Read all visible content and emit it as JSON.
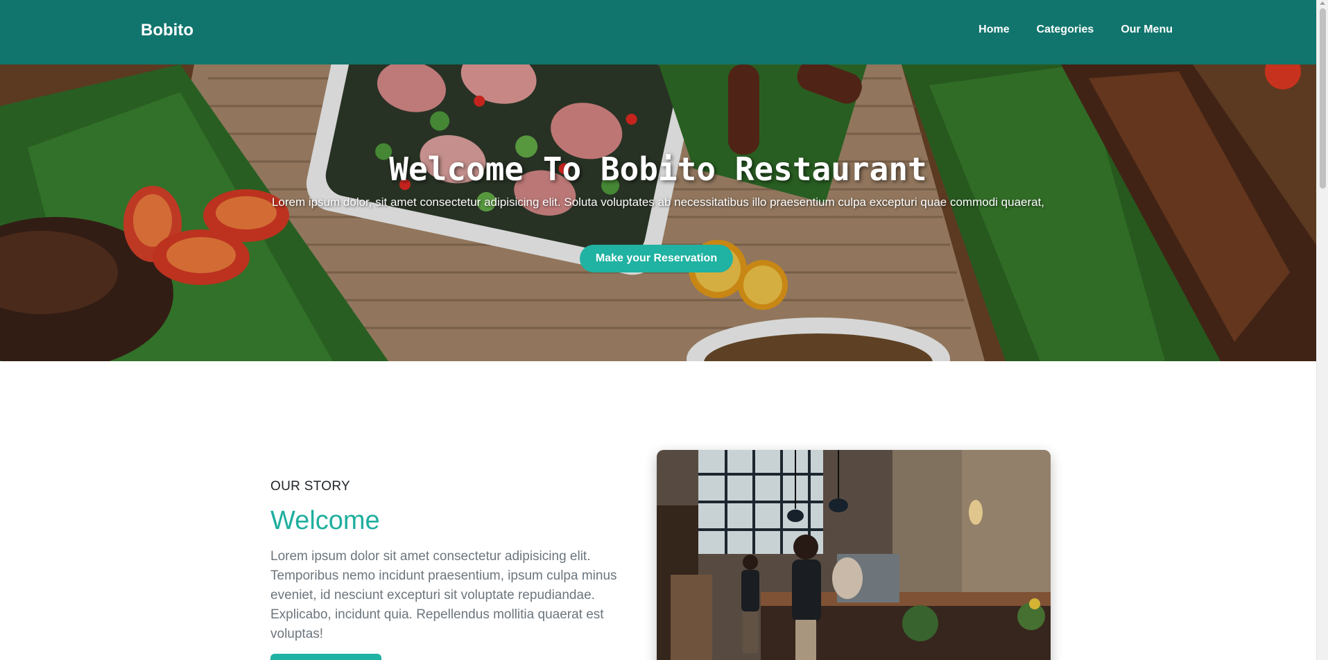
{
  "navbar": {
    "brand": "Bobito",
    "links": [
      "Home",
      "Categories",
      "Our Menu"
    ],
    "background": "#11756d"
  },
  "hero": {
    "title": "Welcome To Bobito Restaurant",
    "subtitle": "Lorem ipsum dolor, sit amet consectetur adipisicing elit. Soluta voluptates ab necessitatibus illo praesentium culpa excepturi quae commodi quaerat,",
    "cta_label": "Make your Reservation",
    "accent": "#20b2a2"
  },
  "story": {
    "kicker": "OUR STORY",
    "title": "Welcome",
    "text": "Lorem ipsum dolor sit amet consectetur adipisicing elit. Temporibus nemo incidunt praesentium, ipsum culpa minus eveniet, id nesciunt excepturi sit voluptate repudiandae. Explicabo, incidunt quia. Repellendus mollitia quaerat est voluptas!",
    "title_color": "#1fae9f"
  }
}
